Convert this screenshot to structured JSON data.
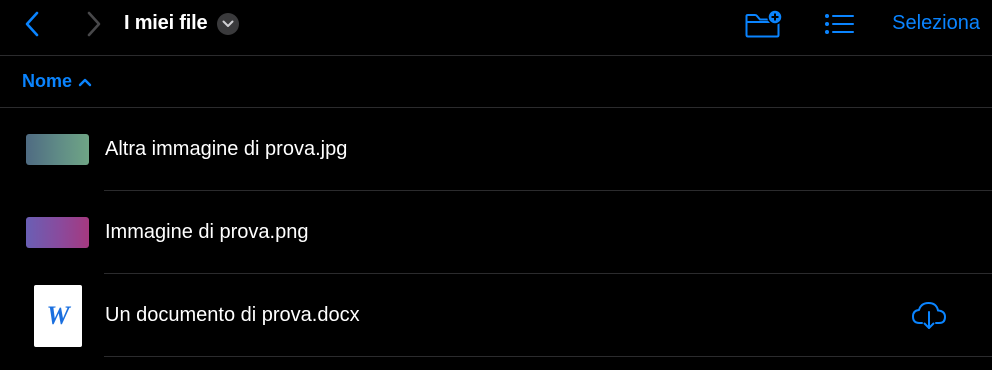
{
  "header": {
    "title": "I miei file",
    "select_label": "Seleziona",
    "icons": {
      "back": "chevron-left-icon",
      "forward": "chevron-right-icon",
      "title_menu": "chevron-down-icon",
      "new_folder": "folder-plus-icon",
      "view_mode": "list-icon"
    }
  },
  "sort": {
    "label": "Nome",
    "direction_icon": "chevron-up-icon"
  },
  "files": [
    {
      "name": "Altra immagine di prova.jpg",
      "kind": "image",
      "colors": [
        "#4f6b82",
        "#6fa585"
      ]
    },
    {
      "name": "Immagine di prova.png",
      "kind": "image",
      "colors": [
        "#6a5fb4",
        "#a5397f"
      ]
    },
    {
      "name": "Un documento di prova.docx",
      "kind": "document",
      "doc_letter": "W",
      "action_icon": "cloud-download-icon"
    }
  ],
  "colors": {
    "accent": "#0a84ff",
    "background": "#000000",
    "text": "#ffffff",
    "separator": "#2b2b2d",
    "disabled": "#48484a"
  }
}
